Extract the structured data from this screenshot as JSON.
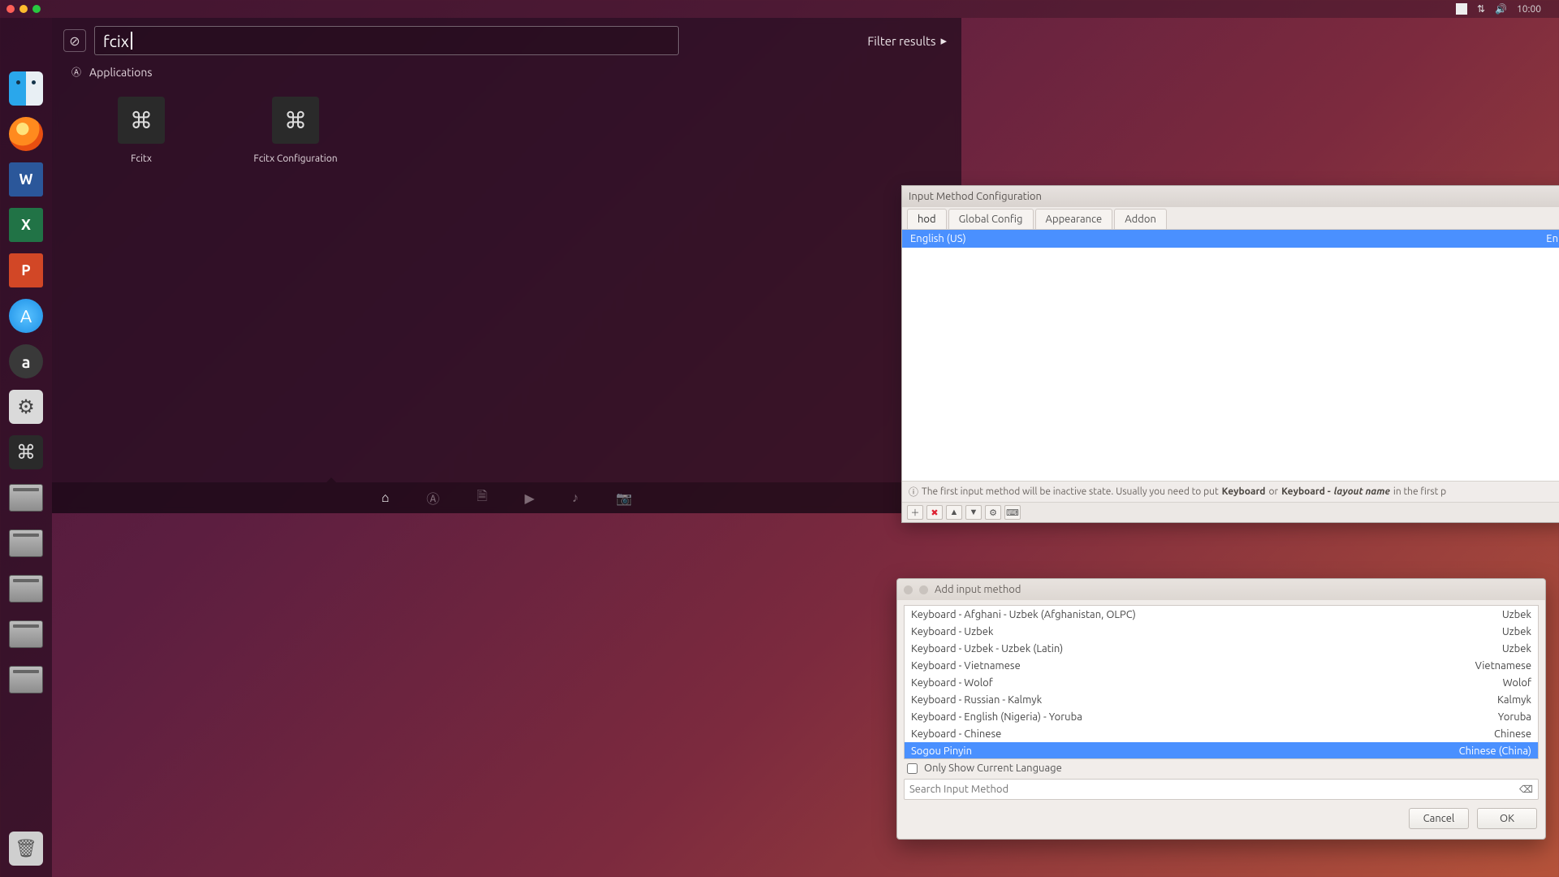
{
  "menubar": {
    "time": "10:00"
  },
  "launcher": {
    "items": [
      {
        "name": "apple-menu",
        "kind": "apple"
      },
      {
        "name": "finder",
        "kind": "finder"
      },
      {
        "name": "firefox",
        "kind": "firefox"
      },
      {
        "name": "word",
        "kind": "office",
        "letter": "W",
        "cls": "ic-word"
      },
      {
        "name": "excel",
        "kind": "office",
        "letter": "X",
        "cls": "ic-word ic-excel"
      },
      {
        "name": "powerpoint",
        "kind": "office",
        "letter": "P",
        "cls": "ic-word ic-ppt"
      },
      {
        "name": "app-store",
        "kind": "store",
        "glyph": "A"
      },
      {
        "name": "amazon",
        "kind": "amazon",
        "letter": "a"
      },
      {
        "name": "system-settings",
        "kind": "settings",
        "glyph": "⚙"
      },
      {
        "name": "fcitx-launcher-icon",
        "kind": "cmd",
        "glyph": "⌘"
      },
      {
        "name": "drive-1",
        "kind": "drive"
      },
      {
        "name": "drive-2",
        "kind": "drive"
      },
      {
        "name": "drive-3",
        "kind": "drive"
      },
      {
        "name": "drive-4",
        "kind": "drive"
      },
      {
        "name": "drive-5",
        "kind": "drive"
      }
    ],
    "trash_name": "trash"
  },
  "dash": {
    "search_value": "fcix",
    "filter_label": "Filter results",
    "section_label": "Applications",
    "apps": [
      {
        "label": "Fcitx"
      },
      {
        "label": "Fcitx Configuration"
      }
    ],
    "lenses": [
      "home",
      "applications",
      "files",
      "video",
      "music",
      "photos"
    ]
  },
  "im_config": {
    "title": "Input Method Configuration",
    "tabs": [
      "hod",
      "Global Config",
      "Appearance",
      "Addon"
    ],
    "tab0_visible_fragment": "hod",
    "entries": [
      {
        "left": "lish (US)",
        "right": "En",
        "visible_left": "English (US)",
        "selected": true
      }
    ],
    "info_prefix": "The first input method will be inactive state. Usually you need to put ",
    "info_kb": "Keyboard",
    "info_or": " or ",
    "info_kb2": "Keyboard - ",
    "info_layout": "layout name",
    "info_suffix": " in the first p",
    "buttons": [
      "add",
      "remove",
      "move-up",
      "move-down",
      "configure",
      "keyboard-layout"
    ]
  },
  "add_dialog": {
    "title": "Add input method",
    "rows": [
      {
        "left": "Keyboard - Afghani - Uzbek (Afghanistan, OLPC)",
        "right": "Uzbek"
      },
      {
        "left": "Keyboard - Uzbek",
        "right": "Uzbek"
      },
      {
        "left": "Keyboard - Uzbek - Uzbek (Latin)",
        "right": "Uzbek"
      },
      {
        "left": "Keyboard - Vietnamese",
        "right": "Vietnamese"
      },
      {
        "left": "Keyboard - Wolof",
        "right": "Wolof"
      },
      {
        "left": "Keyboard - Russian - Kalmyk",
        "right": "Kalmyk"
      },
      {
        "left": "Keyboard - English (Nigeria) - Yoruba",
        "right": "Yoruba"
      },
      {
        "left": "Keyboard - Chinese",
        "right": "Chinese"
      },
      {
        "left": "Sogou Pinyin",
        "right": "Chinese (China)",
        "selected": true
      }
    ],
    "only_current_label": "Only Show Current Language",
    "search_placeholder": "Search Input Method",
    "cancel": "Cancel",
    "ok": "OK"
  }
}
